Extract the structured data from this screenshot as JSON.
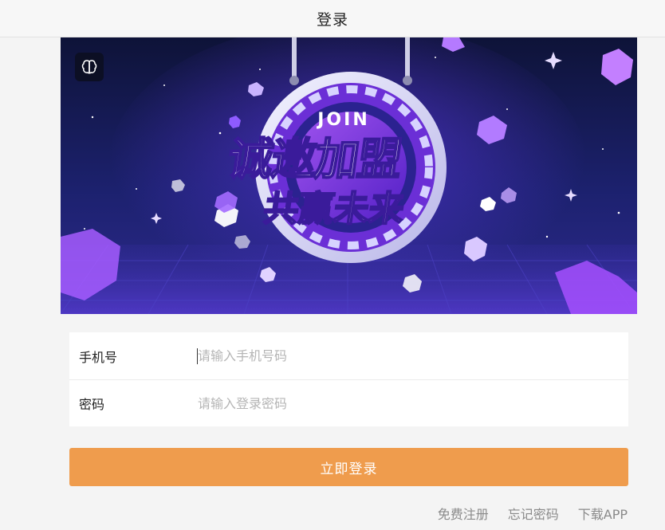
{
  "header": {
    "title": "登录"
  },
  "banner": {
    "badge_text": "JOIN",
    "headline_line1": "诚邀加盟",
    "headline_line2": "共赢未来"
  },
  "form": {
    "phone": {
      "label": "手机号",
      "placeholder": "请输入手机号码",
      "value": ""
    },
    "password": {
      "label": "密码",
      "placeholder": "请输入登录密码",
      "value": ""
    }
  },
  "actions": {
    "login_label": "立即登录"
  },
  "links": {
    "register": "免费注册",
    "forgot": "忘记密码",
    "download": "下载APP"
  },
  "colors": {
    "accent": "#ef9c4d",
    "banner_bg": "#1d1f6e",
    "banner_accent": "#9b4dff"
  }
}
